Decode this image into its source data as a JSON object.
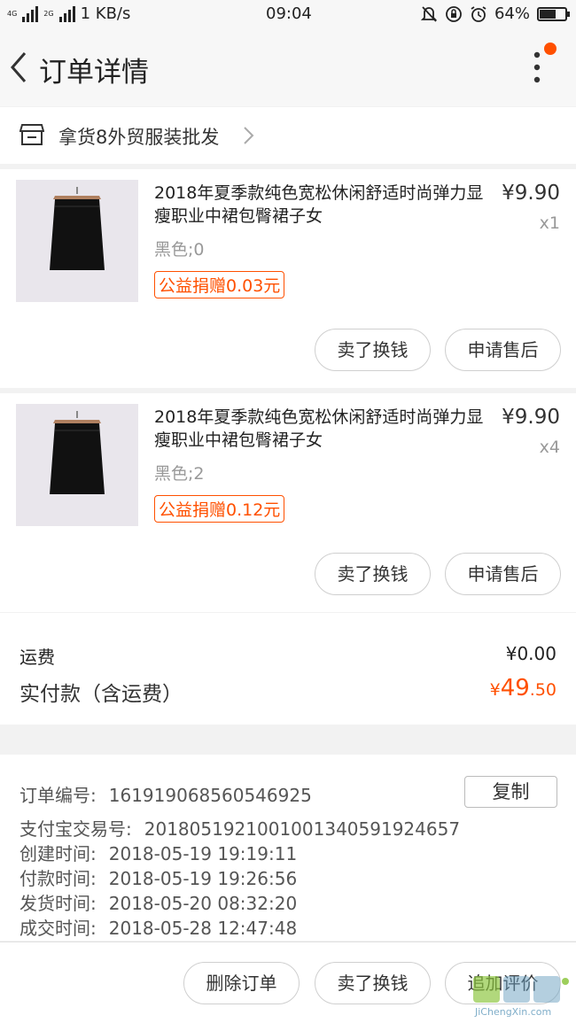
{
  "status_bar": {
    "net_speed": "1 KB/s",
    "time": "09:04",
    "battery": "64%",
    "battery_level": 0.64,
    "sim1": "4G",
    "sim2": "2G"
  },
  "header": {
    "title": "订单详情"
  },
  "shop": {
    "name": "拿货8外贸服装批发"
  },
  "items": [
    {
      "name": "2018年夏季款纯色宽松休闲舒适时尚弹力显瘦职业中裙包臀裙子女",
      "price": "¥9.90",
      "qty": "x1",
      "sku": "黑色;0",
      "charity": "公益捐赠0.03元",
      "btn_sell": "卖了换钱",
      "btn_after_sale": "申请售后"
    },
    {
      "name": "2018年夏季款纯色宽松休闲舒适时尚弹力显瘦职业中裙包臀裙子女",
      "price": "¥9.90",
      "qty": "x4",
      "sku": "黑色;2",
      "charity": "公益捐赠0.12元",
      "btn_sell": "卖了换钱",
      "btn_after_sale": "申请售后"
    }
  ],
  "fees": {
    "shipping_label": "运费",
    "shipping_value": "¥0.00",
    "paid_label": "实付款（含运费）",
    "paid_currency": "¥",
    "paid_integer": "49",
    "paid_decimal": ".50"
  },
  "order_info": {
    "copy_label": "复制",
    "rows": [
      {
        "label": "订单编号:",
        "value": "161919068560546925"
      },
      {
        "label": "支付宝交易号:",
        "value": "2018051921001001340591924657"
      },
      {
        "label": "创建时间:",
        "value": "2018-05-19 19:19:11"
      },
      {
        "label": "付款时间:",
        "value": "2018-05-19 19:26:56"
      },
      {
        "label": "发货时间:",
        "value": "2018-05-20 08:32:20"
      },
      {
        "label": "成交时间:",
        "value": "2018-05-28 12:47:48"
      }
    ]
  },
  "bottom_bar": {
    "delete_order": "删除订单",
    "sell_for_cash": "卖了换钱",
    "add_review": "追加评价"
  },
  "watermark": {
    "domain": "JiChengXin.com",
    "characters": "集诚信"
  },
  "colors": {
    "accent": "#ff5000",
    "background": "#f2f2f2"
  }
}
